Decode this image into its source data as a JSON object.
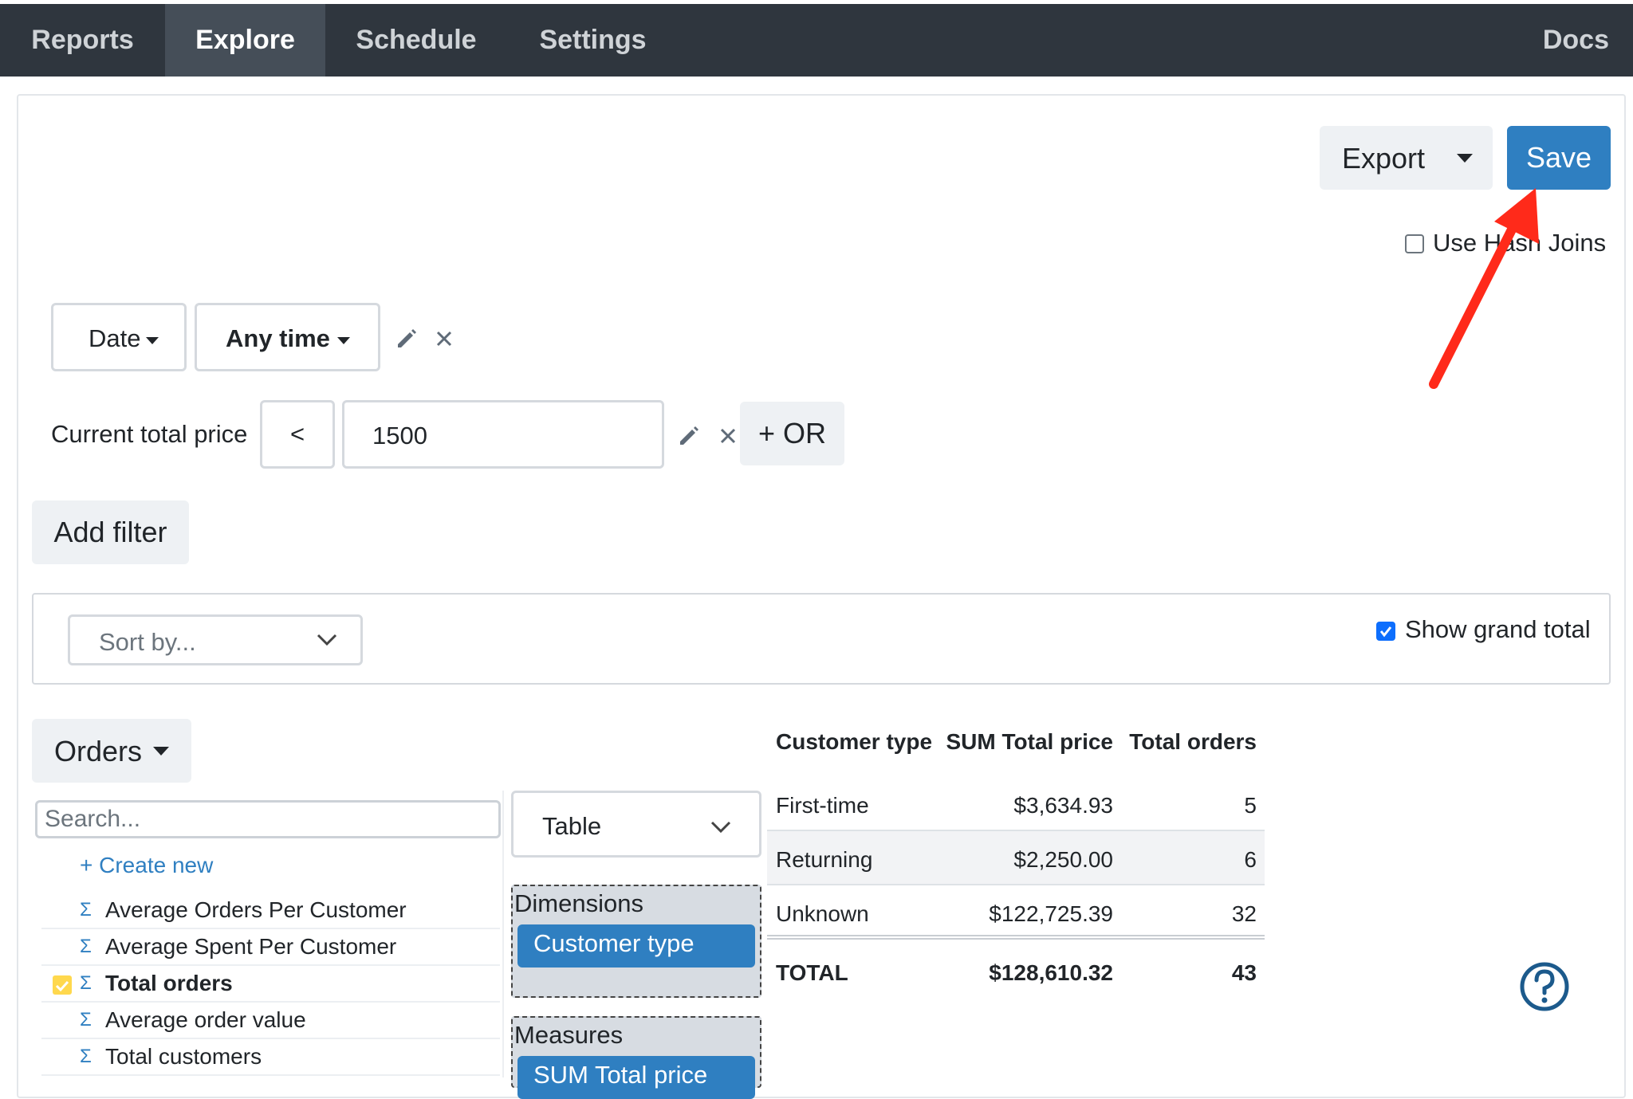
{
  "nav": {
    "tabs": [
      "Reports",
      "Explore",
      "Schedule",
      "Settings"
    ],
    "active": "Explore",
    "docs": "Docs"
  },
  "toolbar": {
    "export_label": "Export",
    "save_label": "Save",
    "hash_joins_label": "Use Hash Joins",
    "hash_joins_checked": false
  },
  "filters": {
    "date_field": "Date",
    "date_range": "Any time",
    "price_label": "Current total price",
    "price_operator": "<",
    "price_value": "1500",
    "or_label": "+ OR",
    "add_filter_label": "Add filter"
  },
  "sort": {
    "placeholder": "Sort by...",
    "grand_total_label": "Show grand total",
    "grand_total_checked": true
  },
  "model": {
    "selector_label": "Orders",
    "search_placeholder": "Search...",
    "create_new": "+ Create new",
    "fields": [
      {
        "label": "Average Orders Per Customer",
        "selected": false
      },
      {
        "label": "Average Spent Per Customer",
        "selected": false
      },
      {
        "label": "Total orders",
        "selected": true
      },
      {
        "label": "Average order value",
        "selected": false
      },
      {
        "label": "Total customers",
        "selected": false
      }
    ]
  },
  "visualization": {
    "type": "Table",
    "dimensions_title": "Dimensions",
    "dimensions": [
      "Customer type"
    ],
    "measures_title": "Measures",
    "measures": [
      "SUM Total price"
    ]
  },
  "results": {
    "headers": [
      "Customer type",
      "SUM Total price",
      "Total orders"
    ],
    "rows": [
      [
        "First-time",
        "$3,634.93",
        "5"
      ],
      [
        "Returning",
        "$2,250.00",
        "6"
      ],
      [
        "Unknown",
        "$122,725.39",
        "32"
      ]
    ],
    "total": [
      "TOTAL",
      "$128,610.32",
      "43"
    ]
  },
  "colors": {
    "accent": "#2f7fc1",
    "nav_bg": "#2f363e",
    "annotation_arrow": "#ff2a1a"
  },
  "icons": {
    "edit": "pencil-icon",
    "remove": "close-icon",
    "help": "question-circle-icon",
    "sigma": "sigma-icon"
  }
}
